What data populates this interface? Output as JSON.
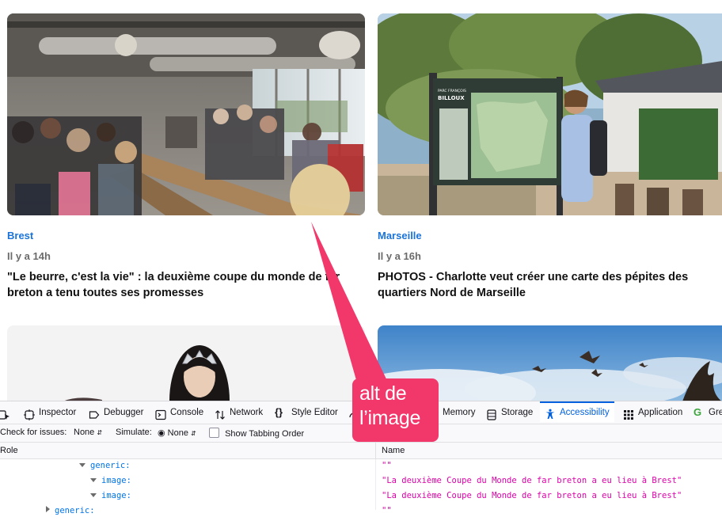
{
  "articles": [
    {
      "city": "Brest",
      "time": "Il y a 14h",
      "headline_line1": "\"Le beurre, c'est la vie\" : la deuxième coupe du monde de far",
      "headline_line2": "breton a tenu toutes ses promesses"
    },
    {
      "city": "Marseille",
      "time": "Il y a 16h",
      "headline_line1": "PHOTOS - Charlotte veut créer une carte des pépites des",
      "headline_line2": "quartiers Nord de Marseille"
    }
  ],
  "sign": {
    "title": "BILLOUX",
    "subtitle": "PARC FRANÇOIS"
  },
  "devtools": {
    "tabs": [
      {
        "label": "Inspector",
        "icon": "inspector-icon"
      },
      {
        "label": "Debugger",
        "icon": "debugger-icon"
      },
      {
        "label": "Console",
        "icon": "console-icon"
      },
      {
        "label": "Network",
        "icon": "network-icon"
      },
      {
        "label": "Style Editor",
        "icon": "style-editor-icon"
      },
      {
        "label": "Memory",
        "icon": "memory-icon"
      },
      {
        "label": "Storage",
        "icon": "storage-icon"
      },
      {
        "label": "Accessibility",
        "icon": "accessibility-icon"
      },
      {
        "label": "Application",
        "icon": "application-icon"
      },
      {
        "label": "Gre",
        "icon": "greasemonkey-icon"
      }
    ],
    "active_tab": "Accessibility",
    "filters": {
      "check_label": "Check for issues:",
      "check_value": "None",
      "simulate_label": "Simulate:",
      "simulate_value": "None",
      "tabbing_label": "Show Tabbing Order"
    },
    "columns": {
      "role": "Role",
      "name": "Name"
    },
    "rows": [
      {
        "role": "generic:",
        "name": "\"\""
      },
      {
        "role": "image:",
        "name": "\"La deuxième Coupe du Monde de far breton a eu lieu à Brest\""
      },
      {
        "role": "image:",
        "name": "\"La deuxième Coupe du Monde de far breton a eu lieu à Brest\""
      },
      {
        "role": "generic:",
        "name": "\"\""
      }
    ]
  },
  "annotation": {
    "line1": "alt de",
    "line2": "l’image",
    "color": "#f2386a"
  },
  "colors": {
    "link": "#1a73d9",
    "accent_tab": "#0061e0",
    "name_value": "#dd00a9",
    "role": "#0074e8"
  }
}
